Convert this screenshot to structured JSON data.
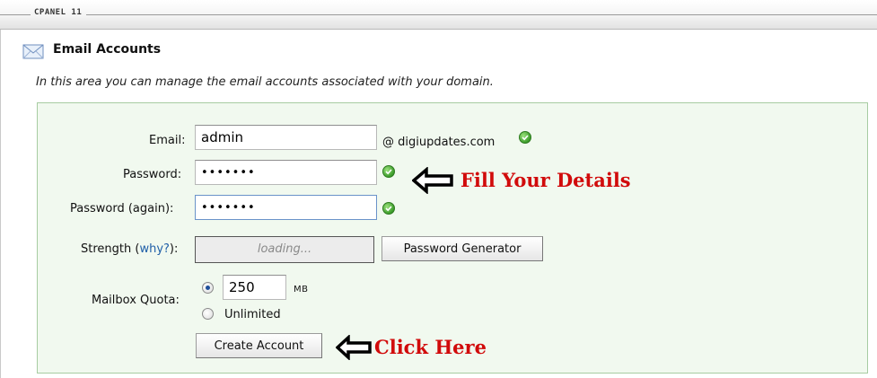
{
  "header": {
    "brand": "CPANEL 11"
  },
  "page": {
    "title": "Email Accounts",
    "description": "In this area you can manage the email accounts associated with your domain.",
    "icon": "mail-envelope-icon"
  },
  "form": {
    "email": {
      "label": "Email:",
      "value": "admin",
      "domain": "@ digiupdates.com"
    },
    "password": {
      "label": "Password:",
      "value": "•••••••"
    },
    "password_again": {
      "label": "Password (again):",
      "value": "•••••••"
    },
    "strength": {
      "label": "Strength (",
      "link": "why?",
      "label_end": "):",
      "value": "loading..."
    },
    "password_generator_label": "Password Generator",
    "quota": {
      "label": "Mailbox Quota:",
      "value": "250",
      "unit": "MB",
      "unlimited_label": "Unlimited",
      "selected": "limited"
    },
    "create_label": "Create Account"
  },
  "annotations": {
    "fill": "Fill Your Details",
    "click": "Click Here",
    "color": "#d10b0b"
  },
  "colors": {
    "panel_bg": "#f1f9ef",
    "panel_border": "#a7cca2",
    "link": "#1f5fa8",
    "valid": "#3d9d2b"
  }
}
